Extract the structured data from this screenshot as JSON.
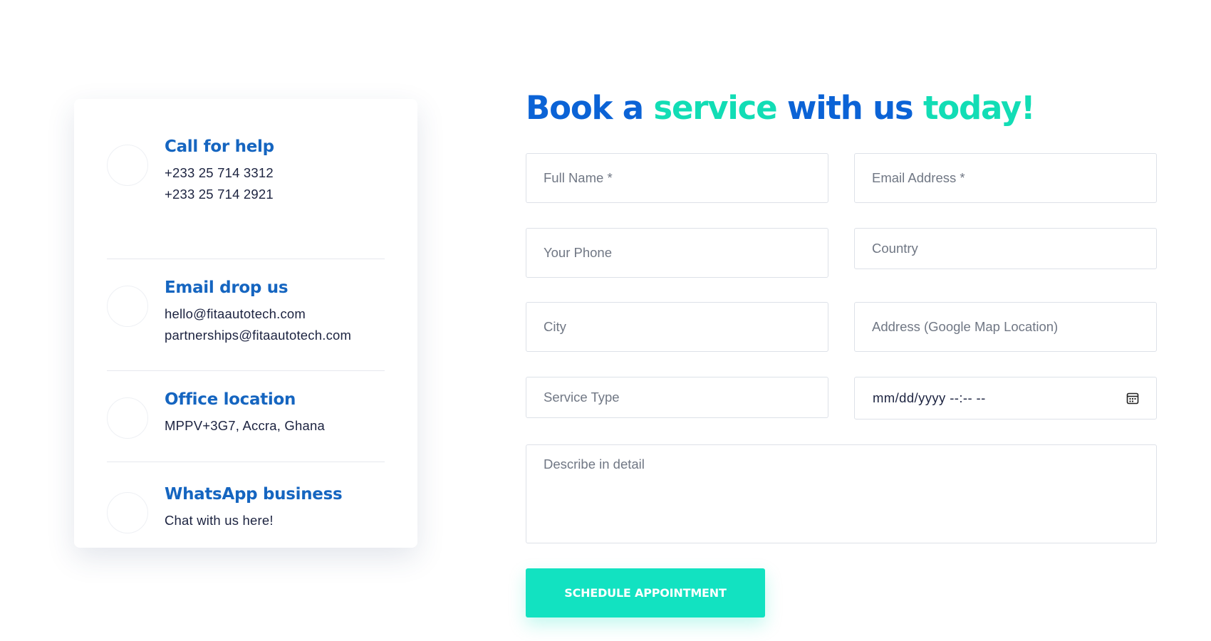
{
  "contact": {
    "items": [
      {
        "icon": "phone-icon",
        "title": "Call for help",
        "lines": [
          "+233 25 714 3312",
          "+233 25 714 2921"
        ]
      },
      {
        "icon": "mail-icon",
        "title": "Email drop us",
        "lines": [
          "hello@fitaautotech.com",
          "partnerships@fitaautotech.com"
        ]
      },
      {
        "icon": "location-icon",
        "title": "Office location",
        "lines": [
          "MPPV+3G7, Accra, Ghana"
        ]
      },
      {
        "icon": "whatsapp-icon",
        "title": "WhatsApp business",
        "lines": [
          "Chat with us here!"
        ]
      }
    ]
  },
  "heading": {
    "part1": "Book a ",
    "part2": "service",
    "part3": " with us ",
    "part4": "today!"
  },
  "form": {
    "full_name_placeholder": "Full Name *",
    "email_placeholder": "Email Address *",
    "phone_placeholder": "Your Phone",
    "country_placeholder": "Country",
    "city_placeholder": "City",
    "address_placeholder": "Address (Google Map Location)",
    "service_type_placeholder": "Service Type",
    "datetime_value": "mm/dd/yyyy --:-- --",
    "details_placeholder": "Describe in detail",
    "submit_label": "SCHEDULE APPOINTMENT"
  },
  "colors": {
    "brand_blue": "#0b63d6",
    "accent_teal": "#12ddb5",
    "title_blue": "#1565c0"
  }
}
